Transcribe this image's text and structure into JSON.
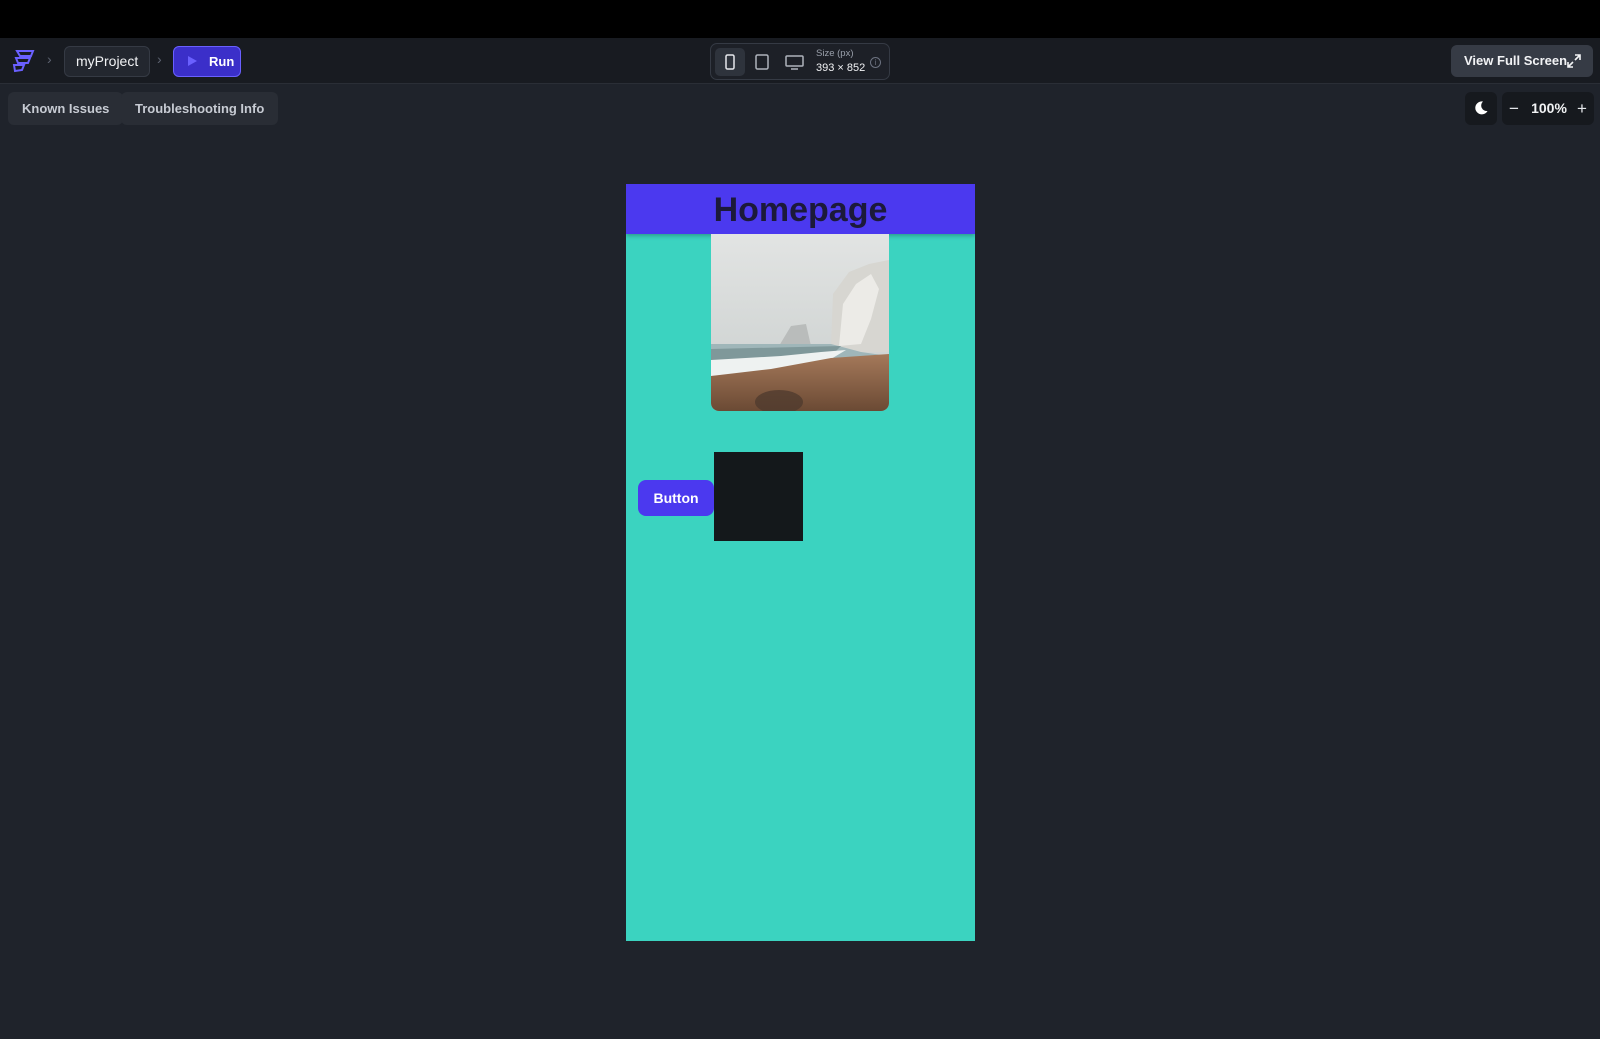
{
  "toolbar": {
    "project_name": "myProject",
    "run_label": "Run",
    "size_label": "Size (px)",
    "size_value": "393 × 852",
    "fullscreen_label": "View Full Screen"
  },
  "subbar": {
    "known_issues_label": "Known Issues",
    "troubleshooting_label": "Troubleshooting Info",
    "zoom_value": "100%"
  },
  "preview": {
    "app_title": "Homepage",
    "button_label": "Button"
  },
  "colors": {
    "accent": "#4b39ef",
    "preview_background": "#3bd3c0",
    "run_button": "#3b2fc9",
    "canvas": "#1f232b",
    "dark_box": "#14181b"
  },
  "icons": [
    "logo-icon",
    "chevron-right-icon",
    "play-icon",
    "phone-icon",
    "tablet-icon",
    "desktop-icon",
    "info-icon",
    "expand-icon",
    "moon-icon",
    "minus-icon",
    "plus-icon"
  ]
}
